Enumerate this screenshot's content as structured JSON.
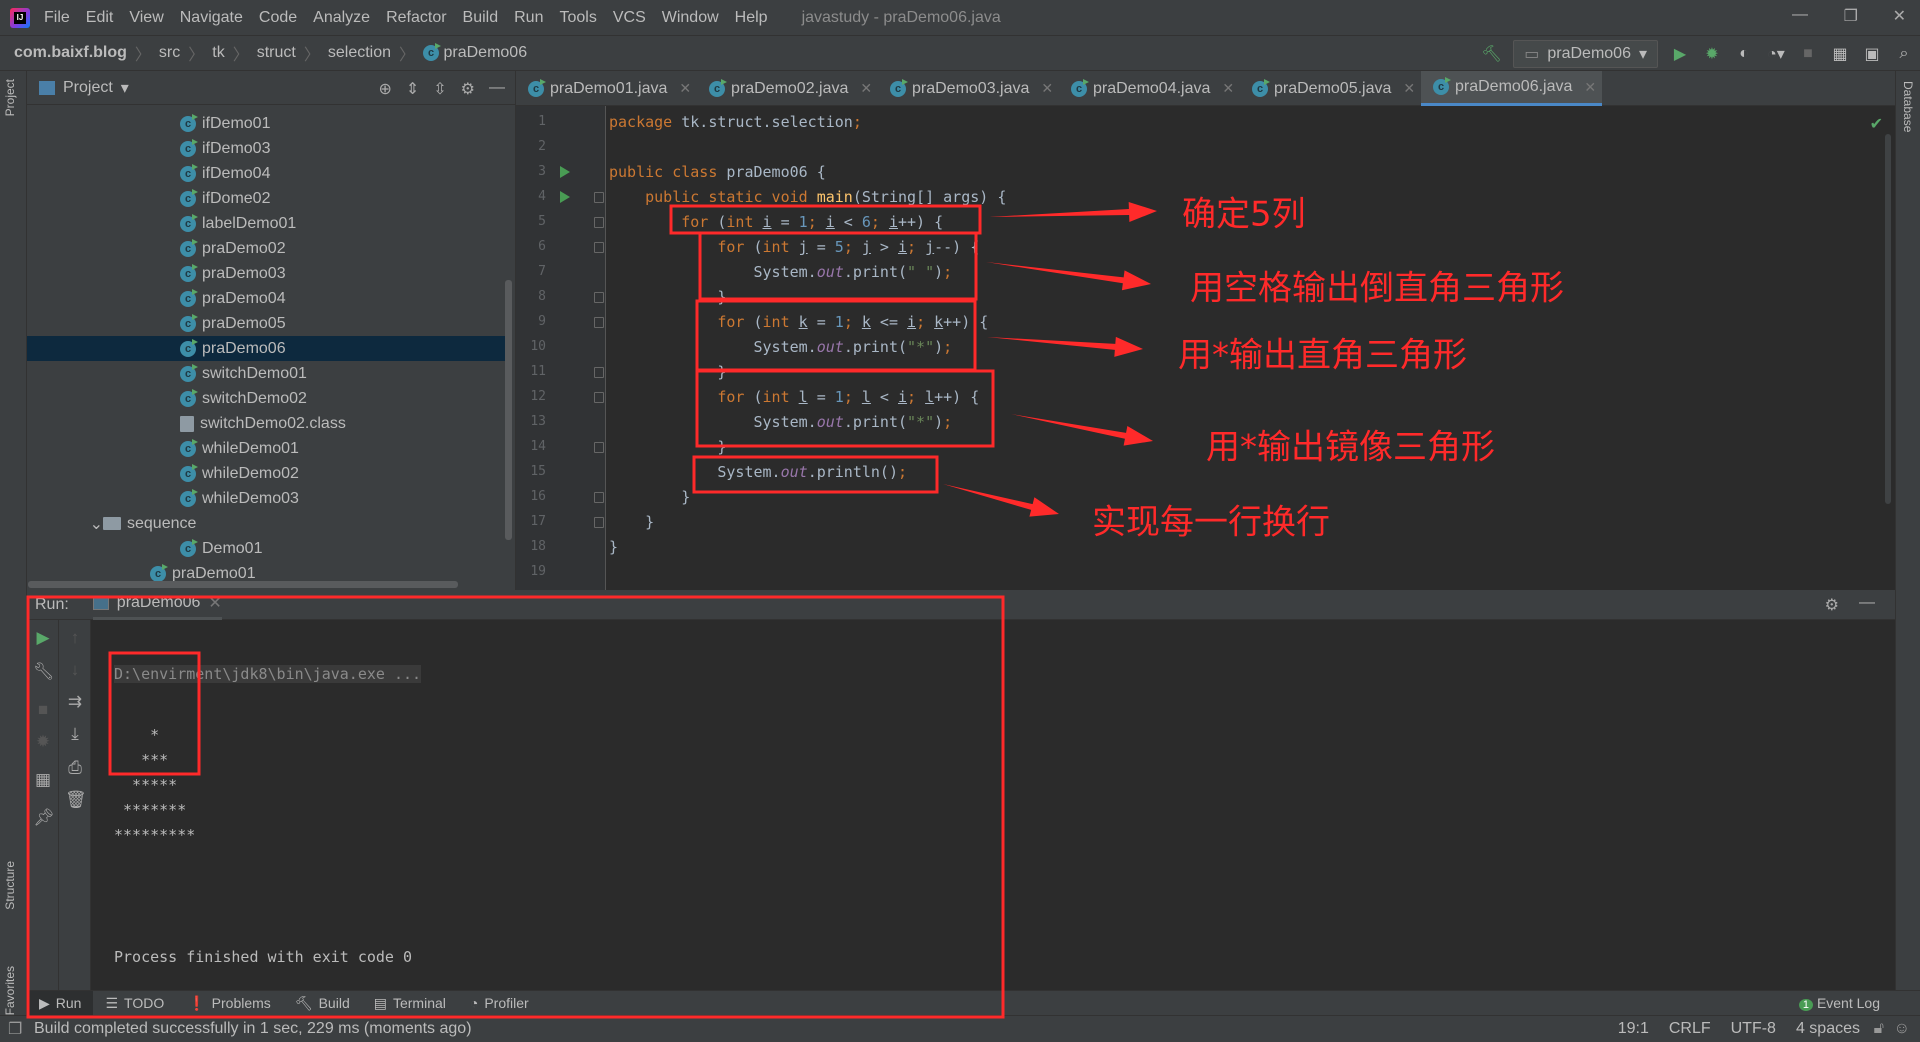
{
  "menubar": {
    "items": [
      "File",
      "Edit",
      "View",
      "Navigate",
      "Code",
      "Analyze",
      "Refactor",
      "Build",
      "Run",
      "Tools",
      "VCS",
      "Window",
      "Help"
    ],
    "title": "javastudy - praDemo06.java"
  },
  "breadcrumb": [
    "com.baixf.blog",
    "src",
    "tk",
    "struct",
    "selection",
    "praDemo06"
  ],
  "run_config": "praDemo06",
  "project": {
    "title": "Project",
    "items": [
      {
        "label": "ifDemo01",
        "type": "class",
        "indent": 2
      },
      {
        "label": "ifDemo03",
        "type": "class",
        "indent": 2
      },
      {
        "label": "ifDemo04",
        "type": "class",
        "indent": 2
      },
      {
        "label": "ifDome02",
        "type": "class",
        "indent": 2
      },
      {
        "label": "labelDemo01",
        "type": "class",
        "indent": 2
      },
      {
        "label": "praDemo02",
        "type": "class",
        "indent": 2
      },
      {
        "label": "praDemo03",
        "type": "class",
        "indent": 2
      },
      {
        "label": "praDemo04",
        "type": "class",
        "indent": 2
      },
      {
        "label": "praDemo05",
        "type": "class",
        "indent": 2
      },
      {
        "label": "praDemo06",
        "type": "class",
        "indent": 2,
        "selected": true
      },
      {
        "label": "switchDemo01",
        "type": "class",
        "indent": 2
      },
      {
        "label": "switchDemo02",
        "type": "class",
        "indent": 2
      },
      {
        "label": "switchDemo02.class",
        "type": "file",
        "indent": 2
      },
      {
        "label": "whileDemo01",
        "type": "class",
        "indent": 2
      },
      {
        "label": "whileDemo02",
        "type": "class",
        "indent": 2
      },
      {
        "label": "whileDemo03",
        "type": "class",
        "indent": 2
      },
      {
        "label": "sequence",
        "type": "folder",
        "indent": 1,
        "expanded": true
      },
      {
        "label": "Demo01",
        "type": "class",
        "indent": 2
      },
      {
        "label": "praDemo01",
        "type": "class",
        "indent": 1
      }
    ]
  },
  "tabs": [
    {
      "label": "praDemo01.java"
    },
    {
      "label": "praDemo02.java"
    },
    {
      "label": "praDemo03.java"
    },
    {
      "label": "praDemo04.java"
    },
    {
      "label": "praDemo05.java"
    },
    {
      "label": "praDemo06.java",
      "active": true
    }
  ],
  "code": [
    [
      {
        "t": "package ",
        "c": "kw"
      },
      {
        "t": "tk.struct.selection",
        "c": ""
      },
      {
        "t": ";",
        "c": "kw"
      }
    ],
    [],
    [
      {
        "t": "public class ",
        "c": "kw"
      },
      {
        "t": "praDemo06 {",
        "c": ""
      }
    ],
    [
      {
        "t": "    public static void ",
        "c": "kw"
      },
      {
        "t": "main",
        "c": "fn"
      },
      {
        "t": "(String[] args) {",
        "c": ""
      }
    ],
    [
      {
        "t": "        for ",
        "c": "kw"
      },
      {
        "t": "(",
        "c": ""
      },
      {
        "t": "int ",
        "c": "kw"
      },
      {
        "t": "i",
        "c": "var"
      },
      {
        "t": " = ",
        "c": ""
      },
      {
        "t": "1",
        "c": "num"
      },
      {
        "t": "; ",
        "c": "kw"
      },
      {
        "t": "i",
        "c": "var"
      },
      {
        "t": " < ",
        "c": ""
      },
      {
        "t": "6",
        "c": "num"
      },
      {
        "t": "; ",
        "c": "kw"
      },
      {
        "t": "i",
        "c": "var"
      },
      {
        "t": "++) {",
        "c": ""
      }
    ],
    [
      {
        "t": "            for ",
        "c": "kw"
      },
      {
        "t": "(",
        "c": ""
      },
      {
        "t": "int ",
        "c": "kw"
      },
      {
        "t": "j",
        "c": "var"
      },
      {
        "t": " = ",
        "c": ""
      },
      {
        "t": "5",
        "c": "num"
      },
      {
        "t": "; ",
        "c": "kw"
      },
      {
        "t": "j",
        "c": "var"
      },
      {
        "t": " > ",
        "c": ""
      },
      {
        "t": "i",
        "c": "var"
      },
      {
        "t": "; ",
        "c": "kw"
      },
      {
        "t": "j",
        "c": "var"
      },
      {
        "t": "--) {",
        "c": ""
      }
    ],
    [
      {
        "t": "                System.",
        "c": ""
      },
      {
        "t": "out",
        "c": "fld"
      },
      {
        "t": ".print(",
        "c": ""
      },
      {
        "t": "\" \"",
        "c": "str"
      },
      {
        "t": ")",
        "c": ""
      },
      {
        "t": ";",
        "c": "kw"
      }
    ],
    [
      {
        "t": "            }",
        "c": ""
      }
    ],
    [
      {
        "t": "            for ",
        "c": "kw"
      },
      {
        "t": "(",
        "c": ""
      },
      {
        "t": "int ",
        "c": "kw"
      },
      {
        "t": "k",
        "c": "var"
      },
      {
        "t": " <= ",
        "c": ""
      },
      {
        "t": "",
        "c": ""
      }
    ],
    [
      {
        "t": "                System.",
        "c": ""
      },
      {
        "t": "out",
        "c": "fld"
      },
      {
        "t": ".print(",
        "c": ""
      },
      {
        "t": "\"*\"",
        "c": "str"
      },
      {
        "t": ")",
        "c": ""
      },
      {
        "t": ";",
        "c": "kw"
      }
    ],
    [
      {
        "t": "            }",
        "c": ""
      }
    ],
    [
      {
        "t": "            for ",
        "c": "kw"
      },
      {
        "t": "(",
        "c": ""
      },
      {
        "t": "int ",
        "c": "kw"
      },
      {
        "t": "l",
        "c": "var"
      },
      {
        "t": " = ",
        "c": ""
      },
      {
        "t": "1",
        "c": "num"
      },
      {
        "t": "; ",
        "c": "kw"
      },
      {
        "t": "l",
        "c": "var"
      },
      {
        "t": " < ",
        "c": ""
      },
      {
        "t": "i",
        "c": "var"
      },
      {
        "t": "; ",
        "c": "kw"
      },
      {
        "t": "l",
        "c": "var"
      },
      {
        "t": "++) {",
        "c": ""
      }
    ],
    [
      {
        "t": "                System.",
        "c": ""
      },
      {
        "t": "out",
        "c": "fld"
      },
      {
        "t": ".print(",
        "c": ""
      },
      {
        "t": "\"*\"",
        "c": "str"
      },
      {
        "t": ")",
        "c": ""
      },
      {
        "t": ";",
        "c": "kw"
      }
    ],
    [
      {
        "t": "            }",
        "c": ""
      }
    ],
    [
      {
        "t": "            System.",
        "c": ""
      },
      {
        "t": "out",
        "c": "fld"
      },
      {
        "t": ".println()",
        "c": ""
      },
      {
        "t": ";",
        "c": "kw"
      }
    ],
    [
      {
        "t": "        }",
        "c": ""
      }
    ],
    [
      {
        "t": "    }",
        "c": ""
      }
    ],
    [
      {
        "t": "}",
        "c": ""
      }
    ],
    []
  ],
  "annotations": [
    "确定5列",
    "用空格输出倒直角三角形",
    "用*输出直角三角形",
    "用*输出镜像三角形",
    "实现每一行换行"
  ],
  "run": {
    "label": "Run:",
    "tab": "praDemo06",
    "command": "D:\\envirment\\jdk8\\bin\\java.exe ...",
    "output": [
      "    *",
      "   ***",
      "  *****",
      " *******",
      "*********"
    ],
    "exit": "Process finished with exit code 0"
  },
  "bottom_tabs": [
    "Run",
    "TODO",
    "Problems",
    "Build",
    "Terminal",
    "Profiler"
  ],
  "event_log": "Event Log",
  "event_count": "1",
  "side_tabs": {
    "project": "Project",
    "structure": "Structure",
    "favorites": "Favorites",
    "database": "Database"
  },
  "status": {
    "message": "Build completed successfully in 1 sec, 229 ms (moments ago)",
    "position": "19:1",
    "line_ending": "CRLF",
    "encoding": "UTF-8",
    "indent": "4 spaces"
  },
  "colors": {
    "annotation": "#ff2a2a",
    "accent": "#4a88c7",
    "selected": "#0d293e"
  }
}
